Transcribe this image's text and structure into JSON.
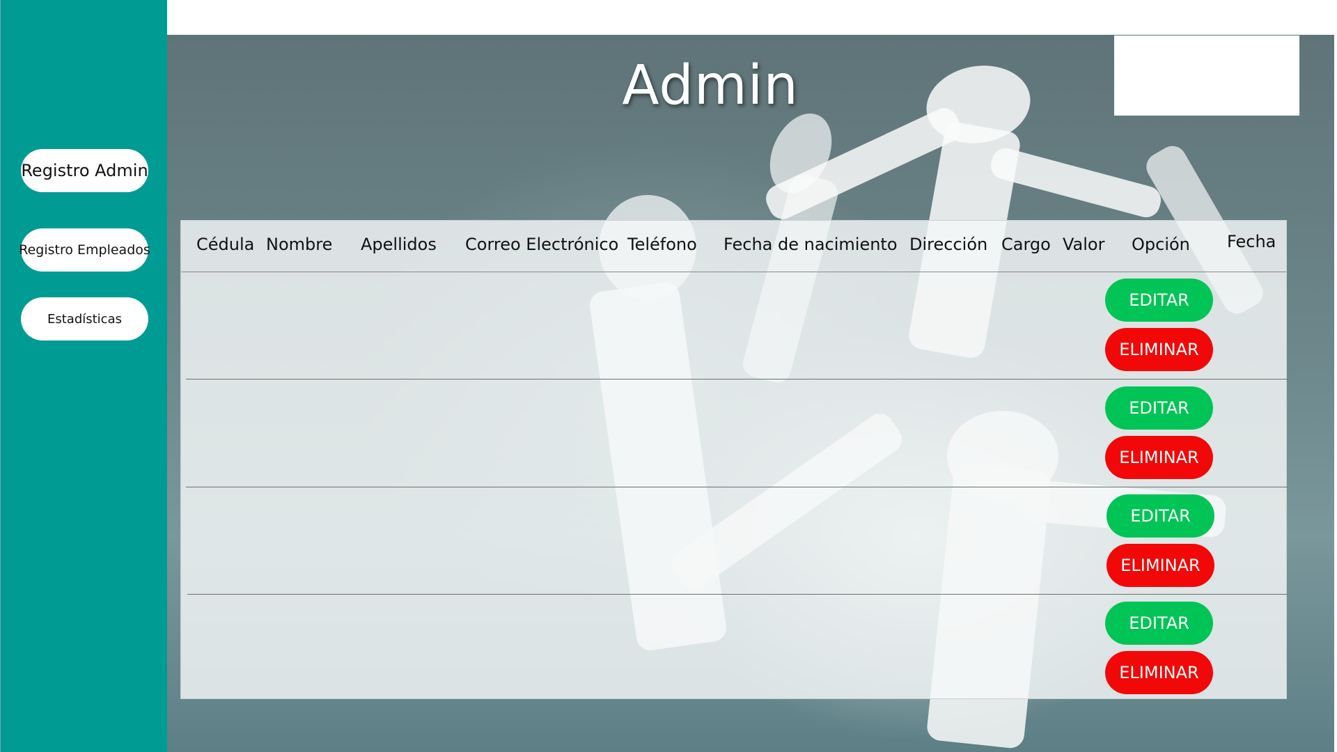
{
  "sidebar": {
    "items": [
      {
        "label": "Registro Admin"
      },
      {
        "label": "Registro Empleados"
      },
      {
        "label": "Estadísticas"
      }
    ]
  },
  "header": {
    "title": "Admin"
  },
  "table": {
    "columns": [
      "Cédula",
      "Nombre",
      "Apellidos",
      "Correo Electrónico",
      "Teléfono",
      "Fecha de nacimiento",
      "Dirección",
      "Cargo",
      "Valor",
      "Opción",
      "Fecha"
    ],
    "rows": [
      {
        "edit_label": "EDITAR",
        "delete_label": "ELIMINAR"
      },
      {
        "edit_label": "EDITAR",
        "delete_label": "ELIMINAR"
      },
      {
        "edit_label": "EDITAR",
        "delete_label": "ELIMINAR"
      },
      {
        "edit_label": "EDITAR",
        "delete_label": "ELIMINAR"
      }
    ]
  },
  "colors": {
    "sidebar": "#009b92",
    "edit_button": "#00c455",
    "delete_button": "#f20808"
  }
}
